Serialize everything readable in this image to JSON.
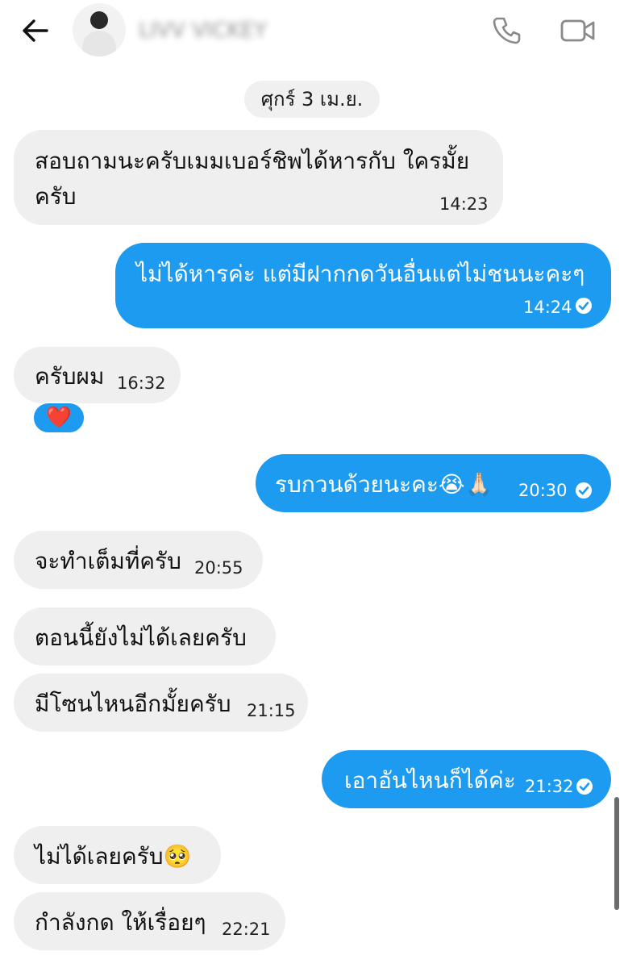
{
  "header": {
    "back_icon": "arrow-left-icon",
    "contact_name": "LIVV VICKEY",
    "call_icon": "phone-icon",
    "video_icon": "video-camera-icon"
  },
  "date_separator": "ศุกร์ 3 เม.ย.",
  "messages": [
    {
      "direction": "in",
      "line1": "สอบถามนะครับเมมเบอร์ชิพได้หารกับ ใครมั้ย",
      "line2": "ครับ",
      "time": "14:23"
    },
    {
      "direction": "out",
      "text": "ไม่ได้หารค่ะ แต่มีฝากกดวันอื่นแต่ไม่ชนนะคะๆ",
      "time": "14:24",
      "status": "sent-check-icon"
    },
    {
      "direction": "in",
      "text": "ครับผม",
      "time": "16:32",
      "reaction": "❤️"
    },
    {
      "direction": "out",
      "text": "รบกวนด้วยนะคะ😭🙏🏻",
      "time": "20:30",
      "status": "sent-check-icon"
    },
    {
      "direction": "in",
      "text": "จะทำเต็มที่ครับ",
      "time": "20:55"
    },
    {
      "direction": "in",
      "text": "ตอนนี้ยังไม่ได้เลยครับ",
      "time": ""
    },
    {
      "direction": "in",
      "text": "มีโซนไหนอีกมั้ยครับ",
      "time": "21:15"
    },
    {
      "direction": "out",
      "text": "เอาอันไหนก็ได้ค่ะ",
      "time": "21:32",
      "status": "sent-check-icon"
    },
    {
      "direction": "in",
      "text": "ไม่ได้เลยครับ🥺",
      "time": ""
    },
    {
      "direction": "in",
      "text": "กำลังกด ให้เรื่อยๆ",
      "time": "22:21"
    }
  ],
  "colors": {
    "outgoing_bubble": "#1d9bf0",
    "incoming_bubble": "#efefef",
    "date_chip": "#f0f0f0",
    "icon_gray": "#8a8a8a"
  }
}
